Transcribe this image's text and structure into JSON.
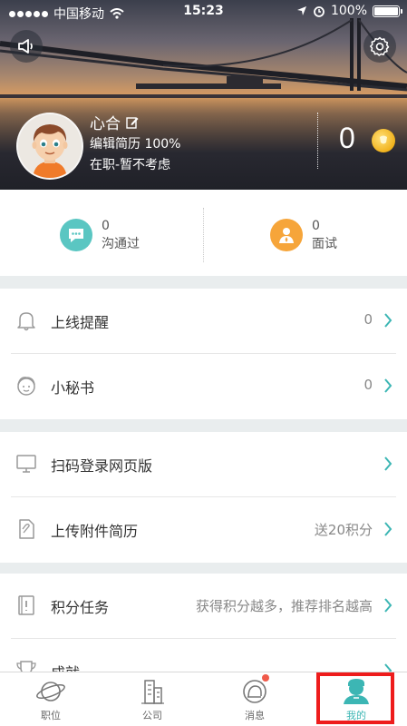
{
  "status_bar": {
    "carrier": "中国移动",
    "time": "15:23",
    "battery": "100%"
  },
  "profile": {
    "name": "心合",
    "resume": "编辑简历 100%",
    "job_status": "在职-暂不考虑",
    "coins": "0"
  },
  "stats": [
    {
      "count": "0",
      "label": "沟通过"
    },
    {
      "count": "0",
      "label": "面试"
    }
  ],
  "menu": [
    {
      "label": "上线提醒",
      "value": "0"
    },
    {
      "label": "小秘书",
      "value": "0"
    },
    {
      "label": "扫码登录网页版",
      "value": ""
    },
    {
      "label": "上传附件简历",
      "value": "送20积分"
    },
    {
      "label": "积分任务",
      "value": "获得积分越多，推荐排名越高"
    },
    {
      "label": "成就",
      "value": ""
    }
  ],
  "tabs": [
    {
      "label": "职位"
    },
    {
      "label": "公司"
    },
    {
      "label": "消息"
    },
    {
      "label": "我的"
    }
  ],
  "colors": {
    "accent": "#3cb6b4",
    "chat_icon": "#5ac6c2",
    "interview_icon": "#f6a53a",
    "highlight_box": "#ee1c1c"
  }
}
